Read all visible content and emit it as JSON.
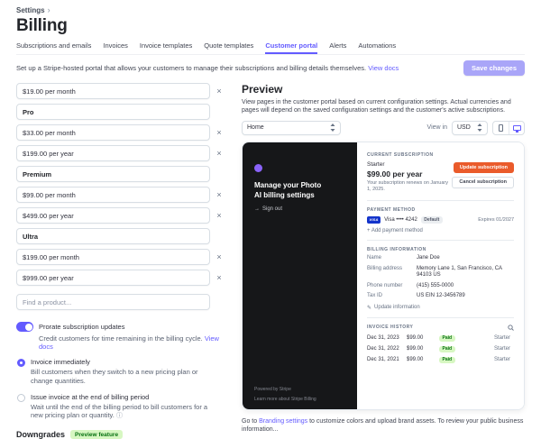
{
  "colors": {
    "accent": "#635bff",
    "save_button_bg": "#a9a5f8",
    "update_button_bg": "#ea5b2b",
    "paid_badge_bg": "#d7f7c2",
    "paid_badge_text": "#077111",
    "dark_panel_bg": "#161719",
    "visa_badge_bg": "#1434cb"
  },
  "icons": {
    "breadcrumb_chevron": "›",
    "close": "×",
    "info": "ⓘ",
    "signout_arrow": "→",
    "pencil": "✎"
  },
  "breadcrumb": {
    "label": "Settings"
  },
  "page": {
    "title": "Billing"
  },
  "tabs": [
    {
      "label": "Subscriptions and emails",
      "active": false
    },
    {
      "label": "Invoices",
      "active": false
    },
    {
      "label": "Invoice templates",
      "active": false
    },
    {
      "label": "Quote templates",
      "active": false
    },
    {
      "label": "Customer portal",
      "active": true
    },
    {
      "label": "Alerts",
      "active": false
    },
    {
      "label": "Automations",
      "active": false
    }
  ],
  "header": {
    "intro": "Set up a Stripe-hosted portal that allows your customers to manage their subscriptions and billing details themselves.",
    "docs_link": "View docs",
    "save_button": "Save changes"
  },
  "products": {
    "items": [
      {
        "type": "price",
        "label": "$19.00 per month"
      },
      {
        "type": "product",
        "label": "Pro"
      },
      {
        "type": "price",
        "label": "$33.00 per month"
      },
      {
        "type": "price",
        "label": "$199.00 per year"
      },
      {
        "type": "product",
        "label": "Premium"
      },
      {
        "type": "price",
        "label": "$99.00 per month"
      },
      {
        "type": "price",
        "label": "$499.00 per year"
      },
      {
        "type": "product",
        "label": "Ultra"
      },
      {
        "type": "price",
        "label": "$199.00 per month"
      },
      {
        "type": "price",
        "label": "$999.00 per year"
      }
    ],
    "find_placeholder": "Find a product..."
  },
  "prorate": {
    "label": "Prorate subscription updates",
    "description": "Credit customers for time remaining in the billing cycle.",
    "docs_link": "View docs",
    "options": [
      {
        "label": "Invoice immediately",
        "description": "Bill customers when they switch to a new pricing plan or change quantities.",
        "selected": true
      },
      {
        "label": "Issue invoice at the end of billing period",
        "description": "Wait until the end of the billing period to bill customers for a new pricing plan or quantity.",
        "selected": false
      }
    ]
  },
  "downgrades": {
    "title": "Downgrades",
    "badge": "Preview feature"
  },
  "preview": {
    "title": "Preview",
    "description": "View pages in the customer portal based on current configuration settings. Actual currencies and pages will depend on the saved configuration settings and the customer's active subscriptions.",
    "page_select_value": "Home",
    "view_in_label": "View in",
    "currency_select_value": "USD",
    "footnote_prefix": "Go to ",
    "footnote_link": "Branding settings",
    "footnote_suffix": " to customize colors and upload brand assets. To review your public business information..."
  },
  "portal": {
    "brand_heading": "Manage your Photo AI billing settings",
    "sign_out": "Sign out",
    "powered_by": "Powered by Stripe",
    "footer_links": "Learn more about Stripe Billing",
    "current_subscription": {
      "label": "CURRENT SUBSCRIPTION",
      "plan": "Starter",
      "price": "$99.00 per year",
      "renewal": "Your subscription renews on January 1, 2025.",
      "update_button": "Update subscription",
      "cancel_button": "Cancel subscription"
    },
    "payment_method": {
      "label": "PAYMENT METHOD",
      "card_brand": "VISA",
      "card_text": "Visa •••• 4242",
      "default_badge": "Default",
      "expires": "Expires 01/2027",
      "add_link": "+ Add payment method"
    },
    "billing_information": {
      "label": "BILLING INFORMATION",
      "rows": [
        {
          "label": "Name",
          "value": "Jane Doe"
        },
        {
          "label": "Billing address",
          "value": "Memory Lane 1, San Francisco, CA 94103 US"
        },
        {
          "label": "Phone number",
          "value": "(415) 555-0000"
        },
        {
          "label": "Tax ID",
          "value": "US EIN 12-3456789"
        }
      ],
      "update_link": "Update information"
    },
    "invoice_history": {
      "label": "INVOICE HISTORY",
      "rows": [
        {
          "date": "Dec 31, 2023",
          "amount": "$99.00",
          "status": "Paid",
          "plan": "Starter"
        },
        {
          "date": "Dec 31, 2022",
          "amount": "$99.00",
          "status": "Paid",
          "plan": "Starter"
        },
        {
          "date": "Dec 31, 2021",
          "amount": "$99.00",
          "status": "Paid",
          "plan": "Starter"
        }
      ]
    }
  }
}
